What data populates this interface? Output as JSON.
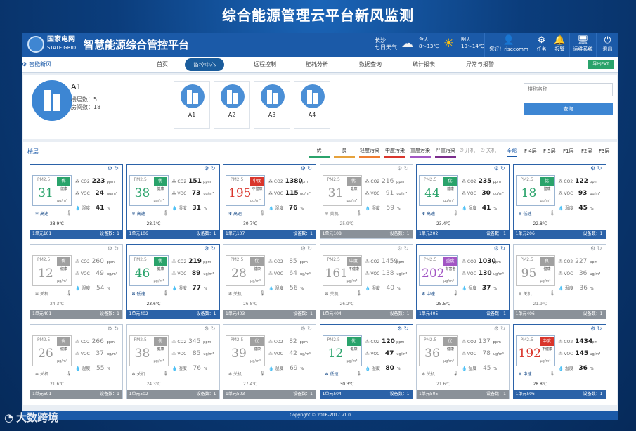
{
  "main_title": "综合能源管理云平台新风监测",
  "header": {
    "logo_text": "国家电网",
    "logo_sub": "STATE GRID",
    "system_title": "智慧能源综合管控平台",
    "city": "长沙",
    "city_sub": "七日天气",
    "today": {
      "label": "今天",
      "temp": "8～13℃",
      "icon": "cloud-sun-icon"
    },
    "tomorrow": {
      "label": "明天",
      "temp": "10～14℃",
      "icon": "sun-icon"
    },
    "user_greeting": "您好！risecomm",
    "tools": [
      {
        "label": "任务",
        "icon": "gear-icon",
        "glyph": "⚙"
      },
      {
        "label": "报警",
        "icon": "bell-icon",
        "glyph": "🔔"
      },
      {
        "label": "运维系统",
        "icon": "monitor-icon",
        "glyph": "🖥"
      },
      {
        "label": "退出",
        "icon": "power-icon",
        "glyph": "⏻"
      }
    ]
  },
  "nav": {
    "brand": "智能新风",
    "export": "导出EXT",
    "items": [
      {
        "label": "首页"
      },
      {
        "label": "监控中心",
        "active": true
      },
      {
        "label": "远程控制"
      },
      {
        "label": "能耗分析"
      },
      {
        "label": "数据查询"
      },
      {
        "label": "统计报表"
      },
      {
        "label": "异常与报警"
      }
    ]
  },
  "building": {
    "name": "A1",
    "floors": "楼层数：5",
    "rooms": "房间数：18",
    "thumbs": [
      "A1",
      "A2",
      "A3",
      "A4"
    ],
    "search_placeholder": "楼称名称",
    "search_button": "查询"
  },
  "floors": {
    "label": "楼层",
    "legend": [
      {
        "label": "优",
        "color": "#2aa36b"
      },
      {
        "label": "良",
        "color": "#e6a23c"
      },
      {
        "label": "轻度污染",
        "color": "#ef7d31"
      },
      {
        "label": "中度污染",
        "color": "#d9362c"
      },
      {
        "label": "重度污染",
        "color": "#a256c4"
      },
      {
        "label": "严重污染",
        "color": "#7b2d8c"
      }
    ],
    "controls": [
      "开机",
      "关机"
    ],
    "tabs": [
      "全部",
      "F 4层",
      "F 5层",
      "F1层",
      "F2层",
      "F3层"
    ]
  },
  "labels": {
    "pm25": "PM2.5",
    "unit": "μg/m³",
    "co2": "CO2",
    "voc": "VOC",
    "ppm": "ppm",
    "ugm3": "ug/m³",
    "hum": "湿度",
    "pct": "%"
  },
  "cards": [
    {
      "room": "1单元101",
      "devices": "设备数：1",
      "on": true,
      "pm": "31",
      "level": "优",
      "note": "健康",
      "co2": "223",
      "voc": "24",
      "hum": "41",
      "mode": "高速",
      "temp": "28.9℃",
      "badge_color": "#2aa36b",
      "value_color": "#2aa36b"
    },
    {
      "room": "1单元106",
      "devices": "设备数：1",
      "on": true,
      "pm": "38",
      "level": "优",
      "note": "健康",
      "co2": "151",
      "voc": "73",
      "hum": "31",
      "mode": "高速",
      "temp": "28.1℃",
      "badge_color": "#2aa36b",
      "value_color": "#2aa36b"
    },
    {
      "room": "1单元107",
      "devices": "设备数：1",
      "on": true,
      "pm": "195",
      "level": "中度",
      "note": "不健康",
      "co2": "1380",
      "voc": "115",
      "hum": "76",
      "mode": "高速",
      "temp": "30.7℃",
      "badge_color": "#d9362c",
      "value_color": "#d9362c"
    },
    {
      "room": "1单元108",
      "devices": "设备数：1",
      "on": false,
      "pm": "31",
      "level": "优",
      "note": "健康",
      "co2": "216",
      "voc": "91",
      "hum": "59",
      "mode": "关机",
      "temp": "25.9℃",
      "badge_color": "#a0a0a0",
      "value_color": "#9a9a9a"
    },
    {
      "room": "1单元202",
      "devices": "设备数：1",
      "on": true,
      "pm": "44",
      "level": "优",
      "note": "健康",
      "co2": "235",
      "voc": "30",
      "hum": "41",
      "mode": "高速",
      "temp": "23.4℃",
      "badge_color": "#2aa36b",
      "value_color": "#2aa36b"
    },
    {
      "room": "1单元206",
      "devices": "设备数：1",
      "on": true,
      "pm": "18",
      "level": "优",
      "note": "健康",
      "co2": "122",
      "voc": "93",
      "hum": "45",
      "mode": "低速",
      "temp": "22.8℃",
      "badge_color": "#2aa36b",
      "value_color": "#2aa36b"
    },
    {
      "room": "1单元401",
      "devices": "设备数：1",
      "on": false,
      "pm": "12",
      "level": "优",
      "note": "健康",
      "co2": "260",
      "voc": "49",
      "hum": "54",
      "mode": "关机",
      "temp": "24.3℃",
      "badge_color": "#a0a0a0",
      "value_color": "#9a9a9a"
    },
    {
      "room": "1单元402",
      "devices": "设备数：1",
      "on": true,
      "pm": "46",
      "level": "优",
      "note": "健康",
      "co2": "219",
      "voc": "89",
      "hum": "77",
      "mode": "低速",
      "temp": "23.6℃",
      "badge_color": "#2aa36b",
      "value_color": "#2aa36b"
    },
    {
      "room": "1单元403",
      "devices": "设备数：1",
      "on": false,
      "pm": "28",
      "level": "优",
      "note": "健康",
      "co2": "85",
      "voc": "64",
      "hum": "56",
      "mode": "关机",
      "temp": "26.8℃",
      "badge_color": "#a0a0a0",
      "value_color": "#9a9a9a"
    },
    {
      "room": "1单元404",
      "devices": "设备数：1",
      "on": false,
      "pm": "161",
      "level": "中度",
      "note": "不健康",
      "co2": "1459",
      "voc": "138",
      "hum": "40",
      "mode": "关机",
      "temp": "26.2℃",
      "badge_color": "#a0a0a0",
      "value_color": "#9a9a9a"
    },
    {
      "room": "1单元405",
      "devices": "设备数：1",
      "on": true,
      "pm": "202",
      "level": "重度",
      "note": "有害者",
      "co2": "1030",
      "voc": "130",
      "hum": "37",
      "mode": "中速",
      "temp": "25.5℃",
      "badge_color": "#a256c4",
      "value_color": "#a256c4"
    },
    {
      "room": "1单元406",
      "devices": "设备数：1",
      "on": false,
      "pm": "95",
      "level": "良",
      "note": "健康",
      "co2": "227",
      "voc": "36",
      "hum": "36",
      "mode": "关机",
      "temp": "21.9℃",
      "badge_color": "#a0a0a0",
      "value_color": "#9a9a9a"
    },
    {
      "room": "1单元501",
      "devices": "设备数：1",
      "on": false,
      "pm": "26",
      "level": "优",
      "note": "健康",
      "co2": "266",
      "voc": "37",
      "hum": "55",
      "mode": "关机",
      "temp": "21.6℃",
      "badge_color": "#a0a0a0",
      "value_color": "#9a9a9a"
    },
    {
      "room": "1单元502",
      "devices": "设备数：1",
      "on": false,
      "pm": "38",
      "level": "优",
      "note": "健康",
      "co2": "345",
      "voc": "85",
      "hum": "76",
      "mode": "关机",
      "temp": "24.3℃",
      "badge_color": "#a0a0a0",
      "value_color": "#9a9a9a"
    },
    {
      "room": "1单元503",
      "devices": "设备数：1",
      "on": false,
      "pm": "39",
      "level": "优",
      "note": "健康",
      "co2": "82",
      "voc": "42",
      "hum": "69",
      "mode": "关机",
      "temp": "27.4℃",
      "badge_color": "#a0a0a0",
      "value_color": "#9a9a9a"
    },
    {
      "room": "1单元504",
      "devices": "设备数：1",
      "on": true,
      "pm": "12",
      "level": "优",
      "note": "健康",
      "co2": "120",
      "voc": "47",
      "hum": "80",
      "mode": "低速",
      "temp": "30.3℃",
      "badge_color": "#2aa36b",
      "value_color": "#2aa36b"
    },
    {
      "room": "1单元505",
      "devices": "设备数：1",
      "on": false,
      "pm": "36",
      "level": "优",
      "note": "健康",
      "co2": "137",
      "voc": "78",
      "hum": "45",
      "mode": "关机",
      "temp": "21.6℃",
      "badge_color": "#a0a0a0",
      "value_color": "#9a9a9a"
    },
    {
      "room": "1单元506",
      "devices": "设备数：1",
      "on": true,
      "pm": "192",
      "level": "中度",
      "note": "不健康",
      "co2": "1434",
      "voc": "145",
      "hum": "36",
      "mode": "中速",
      "temp": "28.8℃",
      "badge_color": "#d9362c",
      "value_color": "#d9362c"
    }
  ],
  "footer": "Copyright © 2016-2017 v1.0",
  "watermark": "大数跨境"
}
